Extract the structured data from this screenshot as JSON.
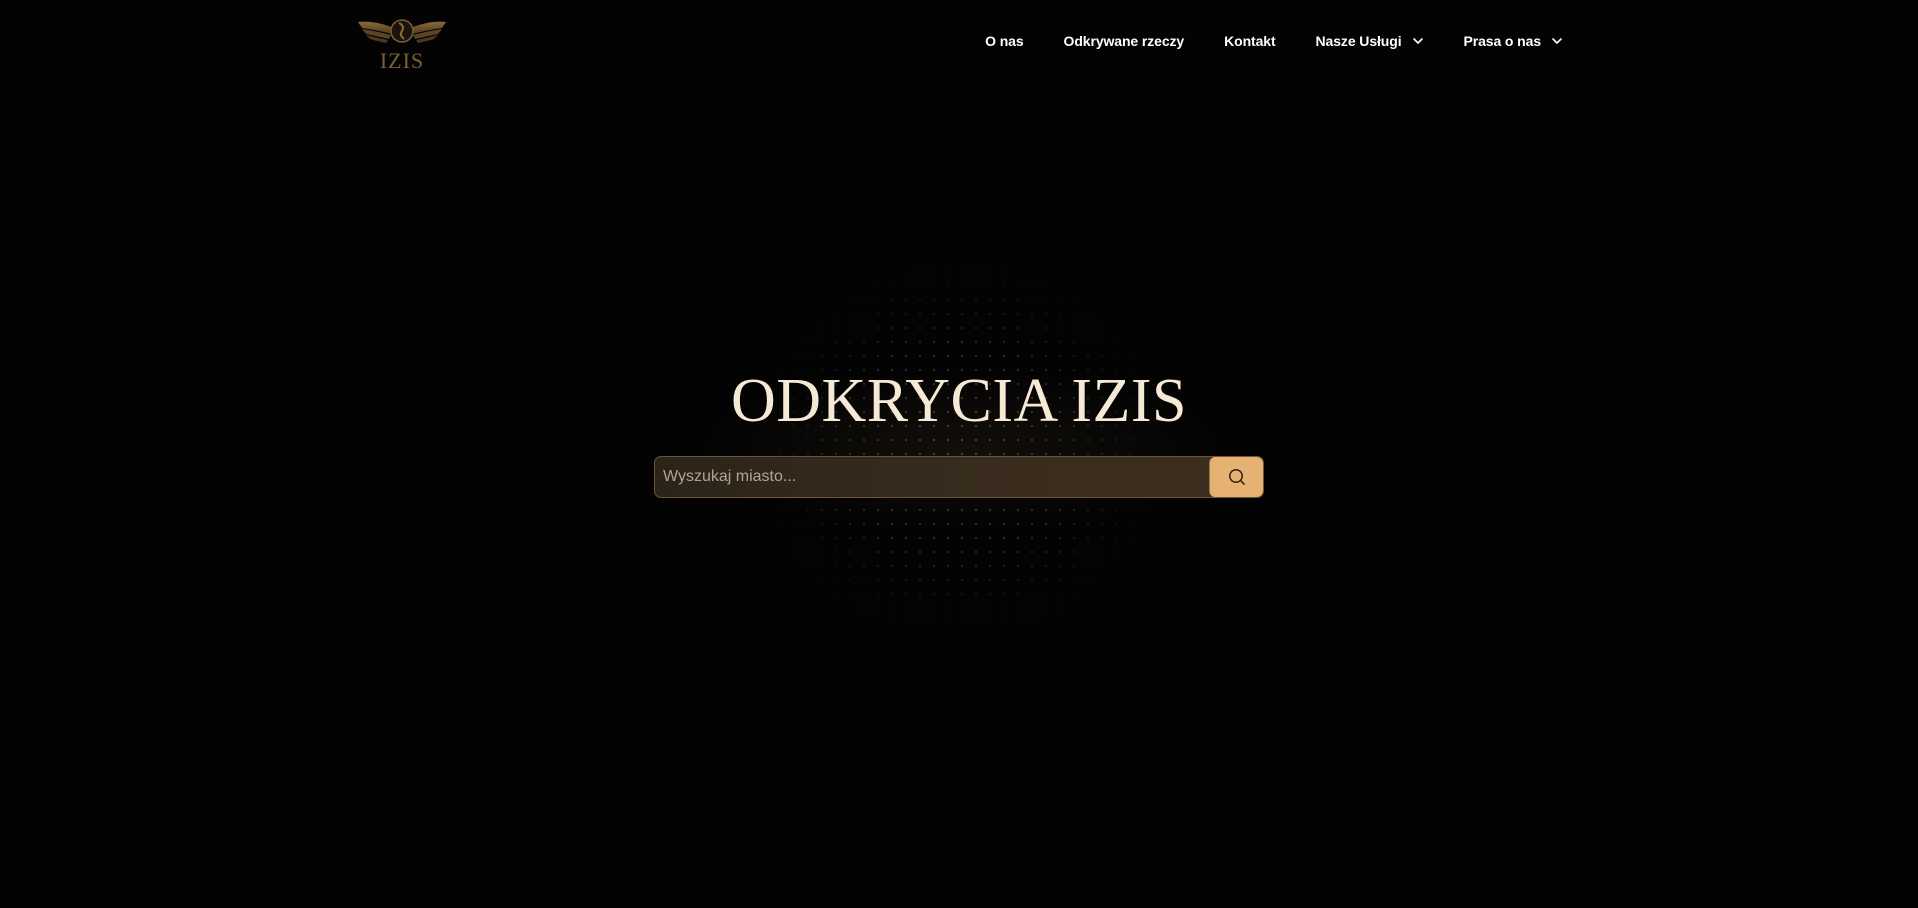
{
  "brand": {
    "logo_text": "IZIS",
    "logo_icon": "winged-scarab-logo-icon",
    "accent_color": "#e6b273",
    "title_color": "#f6ead6"
  },
  "nav": {
    "items": [
      {
        "label": "O nas",
        "has_dropdown": false
      },
      {
        "label": "Odkrywane rzeczy",
        "has_dropdown": false
      },
      {
        "label": "Kontakt",
        "has_dropdown": false
      },
      {
        "label": "Nasze Usługi",
        "has_dropdown": true,
        "icon": "chevron-down-icon"
      },
      {
        "label": "Prasa o nas",
        "has_dropdown": true,
        "icon": "chevron-down-icon"
      }
    ]
  },
  "hero": {
    "title": "ODKRYCIA IZIS"
  },
  "search": {
    "placeholder": "Wyszukaj miasto...",
    "value": "",
    "button_icon": "search-icon"
  }
}
